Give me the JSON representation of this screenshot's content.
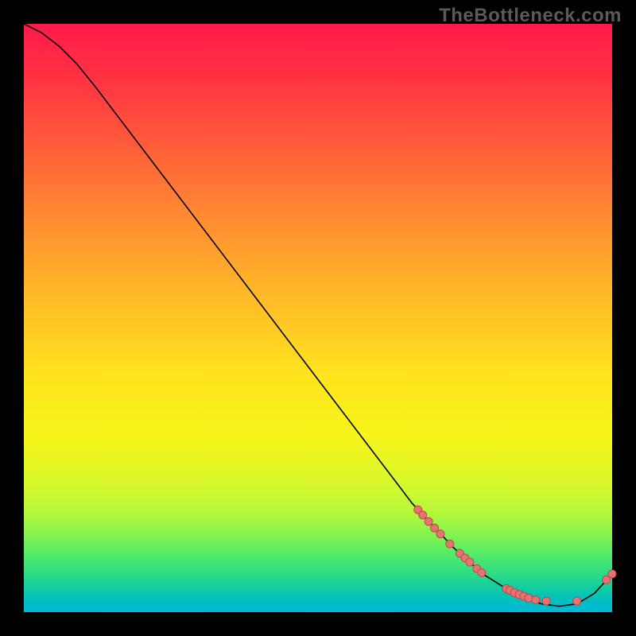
{
  "watermark": "TheBottleneck.com",
  "colors": {
    "page_bg": "#000000",
    "watermark": "#5a5a5a",
    "line": "#000000",
    "dot_fill": "#e57373",
    "dot_stroke": "#c04848"
  },
  "chart_data": {
    "type": "line",
    "title": "",
    "xlabel": "",
    "ylabel": "",
    "xlim": [
      0,
      100
    ],
    "ylim": [
      0,
      100
    ],
    "legend": false,
    "grid": false,
    "series": [
      {
        "name": "curve",
        "x": [
          0,
          3,
          6,
          9,
          12,
          66,
          73,
          78,
          82,
          85,
          88,
          91,
          94,
          97,
          100
        ],
        "y": [
          100,
          98.5,
          96.2,
          93.2,
          89.5,
          18.5,
          11.0,
          6.5,
          4.0,
          2.4,
          1.4,
          1.0,
          1.4,
          3.2,
          6.5
        ]
      }
    ],
    "markers": [
      {
        "x": 67.0,
        "y": 17.4
      },
      {
        "x": 67.8,
        "y": 16.5
      },
      {
        "x": 68.8,
        "y": 15.4
      },
      {
        "x": 69.8,
        "y": 14.3
      },
      {
        "x": 70.8,
        "y": 13.3
      },
      {
        "x": 72.4,
        "y": 11.6
      },
      {
        "x": 74.1,
        "y": 10.0
      },
      {
        "x": 75.0,
        "y": 9.2
      },
      {
        "x": 75.8,
        "y": 8.5
      },
      {
        "x": 77.0,
        "y": 7.4
      },
      {
        "x": 77.8,
        "y": 6.7
      },
      {
        "x": 82.0,
        "y": 4.0
      },
      {
        "x": 82.6,
        "y": 3.7
      },
      {
        "x": 83.4,
        "y": 3.3
      },
      {
        "x": 84.2,
        "y": 3.0
      },
      {
        "x": 85.0,
        "y": 2.7
      },
      {
        "x": 85.8,
        "y": 2.4
      },
      {
        "x": 87.0,
        "y": 2.1
      },
      {
        "x": 88.8,
        "y": 1.9
      },
      {
        "x": 94.0,
        "y": 1.9
      },
      {
        "x": 99.0,
        "y": 5.5
      },
      {
        "x": 100.0,
        "y": 6.5
      }
    ]
  }
}
